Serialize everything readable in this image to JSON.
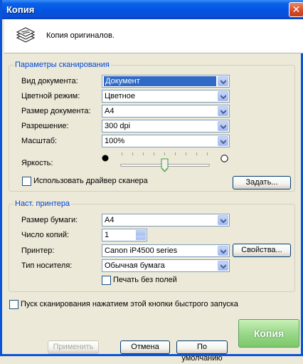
{
  "window": {
    "title": "Копия",
    "close_glyph": "✕"
  },
  "header": {
    "caption": "Копия оригиналов.",
    "icon": "copy-scan-icon"
  },
  "scan_group": {
    "title": "Параметры сканирования",
    "doc_type": {
      "label": "Вид документа:",
      "value": "Документ"
    },
    "color_mode": {
      "label": "Цветной режим:",
      "value": "Цветное"
    },
    "doc_size": {
      "label": "Размер документа:",
      "value": "A4"
    },
    "resolution": {
      "label": "Разрешение:",
      "value": "300 dpi"
    },
    "scale": {
      "label": "Масштаб:",
      "value": "100%"
    },
    "brightness": {
      "label": "Яркость:",
      "level": 0.5
    },
    "use_driver": {
      "label": "Использовать драйвер сканера",
      "checked": false
    },
    "set_button": "Задать..."
  },
  "printer_group": {
    "title": "Наст. принтера",
    "paper_size": {
      "label": "Размер бумаги:",
      "value": "A4"
    },
    "copies": {
      "label": "Число копий:",
      "value": "1"
    },
    "printer": {
      "label": "Принтер:",
      "value": "Canon iP4500 series"
    },
    "properties_button": "Свойства...",
    "media_type": {
      "label": "Тип носителя:",
      "value": "Обычная бумага"
    },
    "borderless": {
      "label": "Печать без полей",
      "checked": false
    }
  },
  "quick_start": {
    "label": "Пуск сканирования нажатием этой кнопки быстрого запуска",
    "checked": false
  },
  "footer": {
    "apply_button": "Применить",
    "cancel_button": "Отмена",
    "default_button": "По умолчанию",
    "copy_button": "Копия"
  }
}
